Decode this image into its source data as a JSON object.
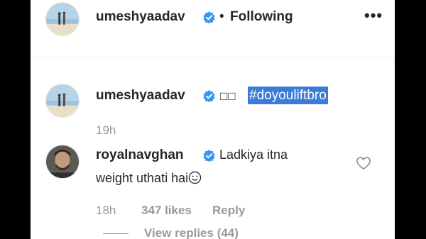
{
  "colors": {
    "accent_verified": "#3897f0",
    "hashtag_highlight": "#3d7bd8",
    "meta_gray": "#999999",
    "text": "#262626"
  },
  "header": {
    "username": "umeshyaadav",
    "separator": "•",
    "follow_status": "Following",
    "more_icon": "•••"
  },
  "caption": {
    "username": "umeshyaadav",
    "boxes": "□□",
    "hashtag": "#doyouliftbro",
    "time": "19h"
  },
  "comment": {
    "username": "royalnavghan",
    "line1": "Ladkiya itna",
    "line2": "weight uthati hai",
    "time": "18h",
    "likes": "347 likes",
    "reply_label": "Reply",
    "view_replies": "View replies (44)"
  }
}
